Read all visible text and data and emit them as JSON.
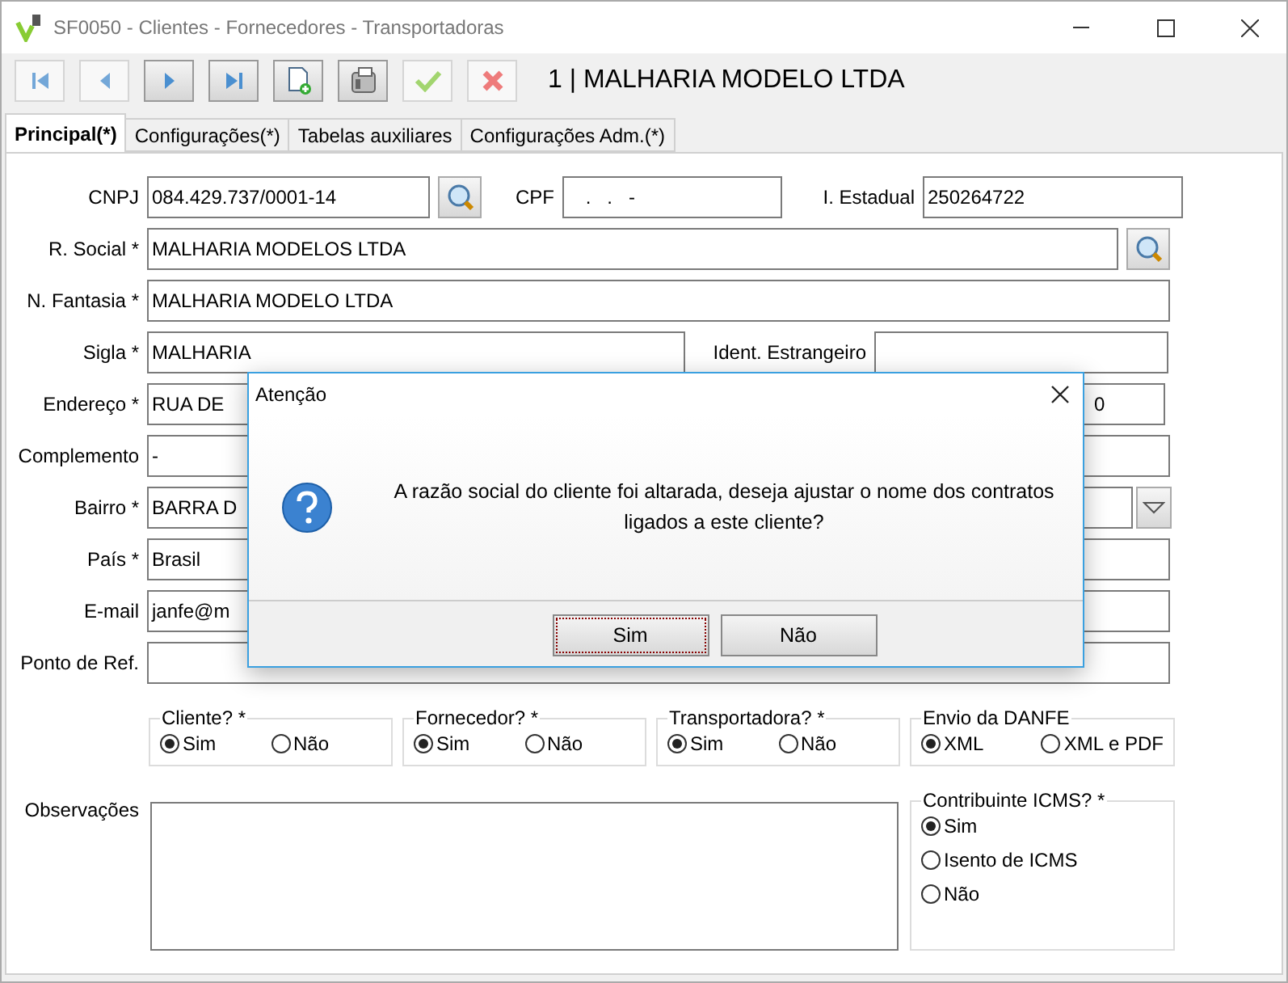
{
  "window": {
    "title": "SF0050 - Clientes - Fornecedores - Transportadoras"
  },
  "toolbar": {
    "buttons": [
      {
        "kind": "first",
        "disabled": true
      },
      {
        "kind": "prev",
        "disabled": true
      },
      {
        "kind": "next",
        "disabled": false
      },
      {
        "kind": "last",
        "disabled": false
      },
      {
        "kind": "new",
        "disabled": false
      },
      {
        "kind": "calc",
        "disabled": false
      },
      {
        "kind": "confirm",
        "disabled": true
      },
      {
        "kind": "cancel",
        "disabled": true
      }
    ],
    "record": "1 | MALHARIA MODELO LTDA"
  },
  "tabs": [
    {
      "label": "Principal(*)",
      "selected": true
    },
    {
      "label": "Configurações(*)",
      "selected": false
    },
    {
      "label": "Tabelas auxiliares",
      "selected": false
    },
    {
      "label": "Configurações Adm.(*)",
      "selected": false
    }
  ],
  "form": {
    "cnpj": {
      "label": "CNPJ",
      "value": "084.429.737/0001-14"
    },
    "cpf": {
      "label": "CPF",
      "value": " .   .   -"
    },
    "ie": {
      "label": "I. Estadual",
      "value": "250264722"
    },
    "razao": {
      "label": "R. Social *",
      "value": "MALHARIA MODELOS LTDA"
    },
    "fantasia": {
      "label": "N. Fantasia *",
      "value": "MALHARIA MODELO LTDA"
    },
    "sigla": {
      "label": "Sigla *",
      "value": "MALHARIA"
    },
    "ident": {
      "label": "Ident. Estrangeiro"
    },
    "endereco": {
      "label": "Endereço *",
      "value": "RUA DE"
    },
    "numero": {
      "value": "0"
    },
    "complemento": {
      "label": "Complemento",
      "value": "-"
    },
    "bairro": {
      "label": "Bairro *",
      "value": "BARRA D"
    },
    "pais": {
      "label": "País *",
      "value": "Brasil"
    },
    "email": {
      "label": "E-mail",
      "value": "janfe@m"
    },
    "referencia": {
      "label": "Ponto de Ref."
    },
    "observacoes": {
      "label": "Observações"
    }
  },
  "groups": [
    {
      "title": "Cliente? *",
      "options": [
        {
          "label": "Sim",
          "selected": true
        },
        {
          "label": "Não",
          "selected": false
        }
      ]
    },
    {
      "title": "Fornecedor? *",
      "options": [
        {
          "label": "Sim",
          "selected": true
        },
        {
          "label": "Não",
          "selected": false
        }
      ]
    },
    {
      "title": "Transportadora? *",
      "options": [
        {
          "label": "Sim",
          "selected": true
        },
        {
          "label": "Não",
          "selected": false
        }
      ]
    },
    {
      "title": "Envio da DANFE",
      "options": [
        {
          "label": "XML",
          "selected": true
        },
        {
          "label": "XML e PDF",
          "selected": false
        }
      ]
    }
  ],
  "icms": {
    "title": "Contribuinte ICMS? *",
    "options": [
      {
        "label": "Sim",
        "selected": true
      },
      {
        "label": "Isento de ICMS",
        "selected": false
      },
      {
        "label": "Não",
        "selected": false
      }
    ]
  },
  "dialog": {
    "title": "Atenção",
    "message": "A razão social do cliente foi altarada, deseja ajustar o nome dos contratos ligados a este cliente?",
    "buttons": [
      {
        "label": "Sim",
        "selected": true
      },
      {
        "label": "Não",
        "selected": false
      }
    ]
  }
}
